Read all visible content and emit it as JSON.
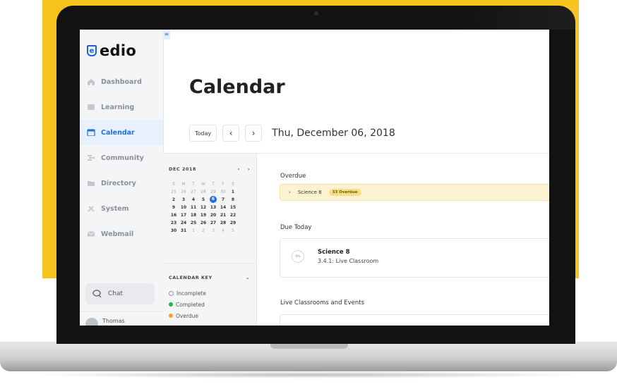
{
  "brand": {
    "name": "edio",
    "logo_letter": "e",
    "accent": "#1f6fe0",
    "backdrop": "#f6c21c"
  },
  "sidebar": {
    "collapse_icon": "≡",
    "items": [
      {
        "label": "Dashboard",
        "icon": "home-icon"
      },
      {
        "label": "Learning",
        "icon": "learning-icon"
      },
      {
        "label": "Calendar",
        "icon": "calendar-icon",
        "active": true
      },
      {
        "label": "Community",
        "icon": "community-icon"
      },
      {
        "label": "Directory",
        "icon": "folder-icon"
      },
      {
        "label": "System",
        "icon": "tools-icon"
      },
      {
        "label": "Webmail",
        "icon": "mail-icon"
      }
    ],
    "chat_label": "Chat",
    "user_name": "Thomas"
  },
  "page": {
    "title": "Calendar",
    "today_label": "Today",
    "prev_label": "‹",
    "next_label": "›",
    "date_title": "Thu, December 06, 2018"
  },
  "mini_calendar": {
    "month_label": "DEC 2018",
    "prev": "‹",
    "next": "›",
    "dow": [
      "S",
      "M",
      "T",
      "W",
      "T",
      "F",
      "S"
    ],
    "weeks": [
      [
        "25",
        "26",
        "27",
        "28",
        "29",
        "30",
        "1"
      ],
      [
        "2",
        "3",
        "4",
        "5",
        "6",
        "7",
        "8"
      ],
      [
        "9",
        "10",
        "11",
        "12",
        "13",
        "14",
        "15"
      ],
      [
        "16",
        "17",
        "18",
        "19",
        "20",
        "21",
        "22"
      ],
      [
        "23",
        "24",
        "25",
        "26",
        "27",
        "28",
        "29"
      ],
      [
        "30",
        "31",
        "1",
        "2",
        "3",
        "4",
        "5"
      ]
    ],
    "selected": "6"
  },
  "calendar_key": {
    "title": "CALENDAR KEY",
    "toggle": "⌄",
    "items": [
      {
        "label": "Incomplete",
        "color": ""
      },
      {
        "label": "Completed",
        "color": "#22b35a"
      },
      {
        "label": "Overdue",
        "color": "#f5a623"
      }
    ]
  },
  "sections": {
    "overdue_label": "Overdue",
    "overdue_course": "Science 8",
    "overdue_badge": "33 Overdue",
    "due_today_label": "Due Today",
    "due_course": "Science 8",
    "due_item": "3.4.1: Live Classroom",
    "due_progress": "0%",
    "live_label": "Live Classrooms and Events"
  }
}
